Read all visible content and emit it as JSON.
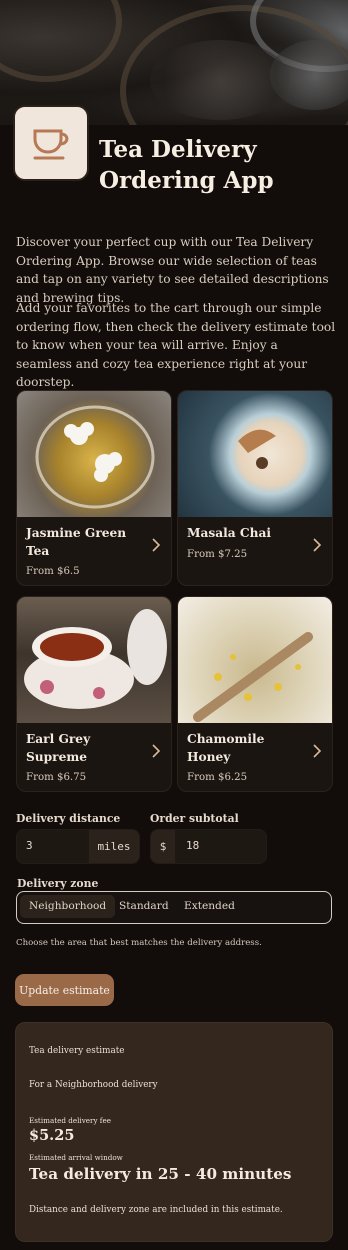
{
  "header": {
    "title": "Tea Delivery Ordering App",
    "icon": "teacup-icon"
  },
  "intro": {
    "p1": "Discover your perfect cup with our Tea Delivery Ordering App. Browse our wide selection of teas and tap on any variety to see detailed descriptions and brewing tips.",
    "p2": "Add your favorites to the cart through our simple ordering flow, then check the delivery estimate tool to know when your tea will arrive. Enjoy a seamless and cozy tea experience right at your doorstep."
  },
  "teas": [
    {
      "name": "Jasmine Green Tea",
      "price": "From $6.5"
    },
    {
      "name": "Masala Chai",
      "price": "From $7.25"
    },
    {
      "name": "Earl Grey Supreme",
      "price": "From $6.75"
    },
    {
      "name": "Chamomile Honey",
      "price": "From $6.25"
    }
  ],
  "form": {
    "distance_label": "Delivery distance",
    "distance_value": "3",
    "distance_unit": "miles",
    "subtotal_label": "Order subtotal",
    "subtotal_prefix": "$",
    "subtotal_value": "18",
    "zone_label": "Delivery zone",
    "zones": [
      "Neighborhood",
      "Standard",
      "Extended"
    ],
    "selected_zone": "Neighborhood",
    "hint": "Choose the area that best matches the delivery address.",
    "button": "Update estimate"
  },
  "estimate": {
    "heading": "Tea delivery estimate",
    "zone_line": "For a Neighborhood delivery",
    "fee_label": "Estimated delivery fee",
    "fee": "$5.25",
    "window_label": "Estimated arrival window",
    "window": "Tea delivery in 25 - 40 minutes",
    "note": "Distance and delivery zone are included in this estimate."
  },
  "colors": {
    "background": "#120d0a",
    "accent": "#9a6a48",
    "card": "#1b1511",
    "result_panel": "#33271e"
  }
}
